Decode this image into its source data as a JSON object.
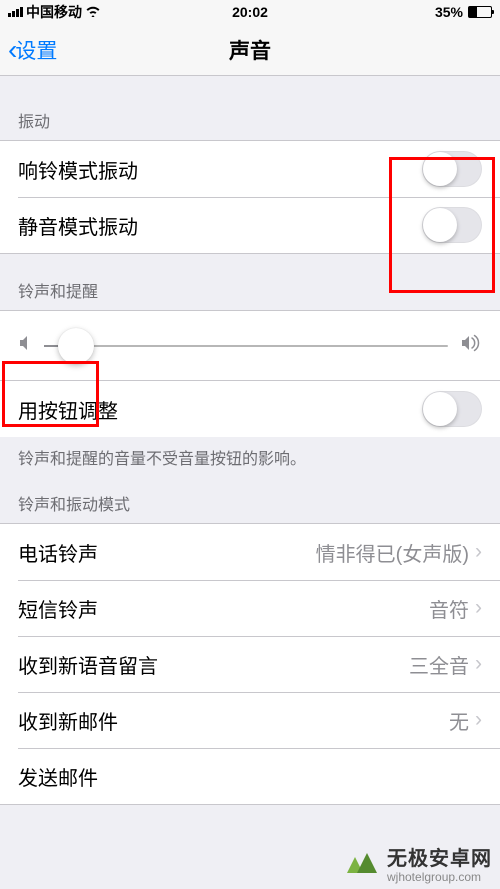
{
  "status": {
    "carrier": "中国移动",
    "time": "20:02",
    "battery_pct": "35%"
  },
  "nav": {
    "back_label": "设置",
    "title": "声音"
  },
  "sections": {
    "vibration": {
      "header": "振动",
      "ring_label": "响铃模式振动",
      "silent_label": "静音模式振动"
    },
    "ringer": {
      "header": "铃声和提醒",
      "button_adjust_label": "用按钮调整",
      "footer": "铃声和提醒的音量不受音量按钮的影响。",
      "slider_value_pct": 8
    },
    "patterns": {
      "header": "铃声和振动模式",
      "items": [
        {
          "label": "电话铃声",
          "value": "情非得已(女声版)"
        },
        {
          "label": "短信铃声",
          "value": "音符"
        },
        {
          "label": "收到新语音留言",
          "value": "三全音"
        },
        {
          "label": "收到新邮件",
          "value": "无"
        },
        {
          "label": "发送邮件",
          "value": ""
        }
      ]
    }
  },
  "watermark": {
    "main": "无极安卓网",
    "sub": "wjhotelgroup.com"
  }
}
